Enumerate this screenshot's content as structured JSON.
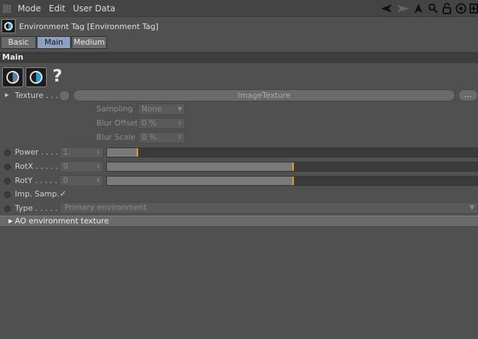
{
  "menu": {
    "items": [
      "Mode",
      "Edit",
      "User Data"
    ]
  },
  "toolbar": {
    "icons": [
      "back-arrow-icon",
      "forward-arrow-icon",
      "cursor-up-icon",
      "search-icon",
      "lock-icon",
      "target-icon",
      "new-panel-icon"
    ]
  },
  "tag": {
    "title": "Environment Tag [Environment Tag]"
  },
  "tabs": [
    {
      "label": "Basic",
      "active": false
    },
    {
      "label": "Main",
      "active": true
    },
    {
      "label": "Medium",
      "active": false
    }
  ],
  "section": {
    "title": "Main"
  },
  "help": {
    "symbol": "?"
  },
  "texture": {
    "label": "Texture . . .",
    "value": "ImageTexture",
    "more": "..."
  },
  "sampling": {
    "label": "Sampling",
    "value": "None"
  },
  "blur_offset": {
    "label": "Blur Offset",
    "value": "0 %"
  },
  "blur_scale": {
    "label": "Blur Scale",
    "value": "0 %"
  },
  "power": {
    "label": "Power . . . .",
    "value": "1.",
    "level": 0.08
  },
  "rotx": {
    "label": "RotX . . . . .",
    "value": "0",
    "level": 0.5
  },
  "roty": {
    "label": "RotY . . . . .",
    "value": "0",
    "level": 0.5
  },
  "imp_samp": {
    "label": "Imp. Samp.",
    "check": "✓"
  },
  "type": {
    "label": "Type . . . . .",
    "value": "Primary environment"
  },
  "ao": {
    "label": "AO environment texture"
  },
  "colors": {
    "accent": "#1e9de3",
    "slider_knob": "#e8a020",
    "active_tab": "#8da0c0"
  }
}
